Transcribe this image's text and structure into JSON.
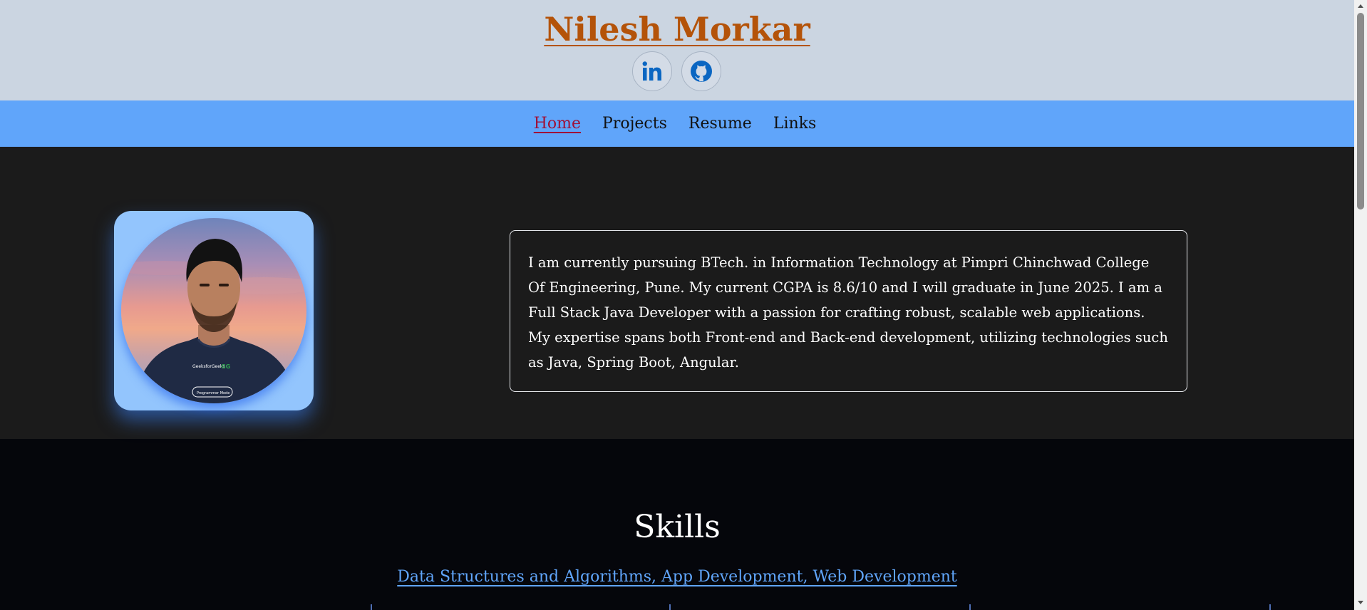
{
  "header": {
    "title": "Nilesh Morkar",
    "socials": [
      {
        "name": "LinkedIn",
        "icon": "linkedin-icon"
      },
      {
        "name": "GitHub",
        "icon": "github-icon"
      }
    ]
  },
  "nav": {
    "items": [
      "Home",
      "Projects",
      "Resume",
      "Links"
    ],
    "active": "Home"
  },
  "about": {
    "text": "I am currently pursuing BTech. in Information Technology at Pimpri Chinchwad College Of Engineering, Pune. My current CGPA is 8.6/10 and I will graduate in June 2025. I am a Full Stack Java Developer with a passion for crafting robust, scalable web applications. My expertise spans both Front-end and Back-end development, utilizing technologies such as Java, Spring Boot, Angular."
  },
  "skills": {
    "title": "Skills",
    "link": "Data Structures and Algorithms, App Development, Web Development"
  },
  "colors": {
    "title": "#b45309",
    "header_bg": "#cbd5e1",
    "nav_bg": "#60a5fa",
    "hero_bg": "#1b1b1b",
    "page_bg": "#05060b",
    "link": "#60a5fa",
    "icon": "#0a66c2"
  }
}
